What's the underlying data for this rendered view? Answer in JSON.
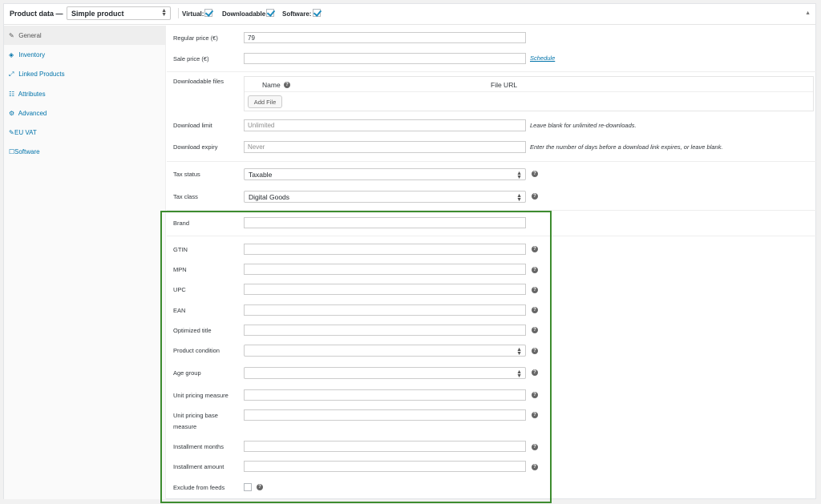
{
  "header": {
    "title": "Product data —",
    "product_type": "Simple product",
    "virtual_label": "Virtual:",
    "virtual_checked": true,
    "downloadable_label": "Downloadable:",
    "downloadable_checked": true,
    "software_label": "Software:",
    "software_checked": true,
    "collapse_glyph": "▲"
  },
  "tabs": [
    {
      "label": "General",
      "icon": "wrench-icon",
      "glyph": "✎",
      "active": true
    },
    {
      "label": "Inventory",
      "icon": "tag-icon",
      "glyph": "◈"
    },
    {
      "label": "Linked Products",
      "icon": "link-icon",
      "glyph": "⤢"
    },
    {
      "label": "Attributes",
      "icon": "list-icon",
      "glyph": "☷"
    },
    {
      "label": "Advanced",
      "icon": "gear-icon",
      "glyph": "⚙"
    },
    {
      "label": "EU VAT",
      "icon": "wrench-icon",
      "glyph": "✎"
    },
    {
      "label": "Software",
      "icon": "checkbox-icon",
      "glyph": "☐"
    }
  ],
  "pricing": {
    "regular_price_label": "Regular price (€)",
    "regular_price_value": "79",
    "sale_price_label": "Sale price (€)",
    "sale_price_value": "",
    "schedule_link": "Schedule"
  },
  "downloads": {
    "files_label": "Downloadable files",
    "col_name": "Name",
    "col_file_url": "File URL",
    "add_file_button": "Add File",
    "limit_label": "Download limit",
    "limit_placeholder": "Unlimited",
    "limit_desc": "Leave blank for unlimited re-downloads.",
    "expiry_label": "Download expiry",
    "expiry_placeholder": "Never",
    "expiry_desc": "Enter the number of days before a download link expires, or leave blank."
  },
  "tax": {
    "status_label": "Tax status",
    "status_value": "Taxable",
    "class_label": "Tax class",
    "class_value": "Digital Goods"
  },
  "feed_fields": {
    "brand_label": "Brand",
    "gtin_label": "GTIN",
    "mpn_label": "MPN",
    "upc_label": "UPC",
    "ean_label": "EAN",
    "optimized_title_label": "Optimized title",
    "product_condition_label": "Product condition",
    "age_group_label": "Age group",
    "unit_pricing_measure_label": "Unit pricing measure",
    "unit_pricing_base_measure_label_1": "Unit pricing base",
    "unit_pricing_base_measure_label_2": "measure",
    "installment_months_label": "Installment months",
    "installment_amount_label": "Installment amount",
    "exclude_from_feeds_label": "Exclude from feeds",
    "exclude_from_feeds_checked": false
  },
  "help_glyph": "?",
  "select_arrows": "▲▼",
  "colors": {
    "link": "#0073aa",
    "highlight_border": "#3d8c2f",
    "checkbox_check": "#1e8cbe"
  }
}
